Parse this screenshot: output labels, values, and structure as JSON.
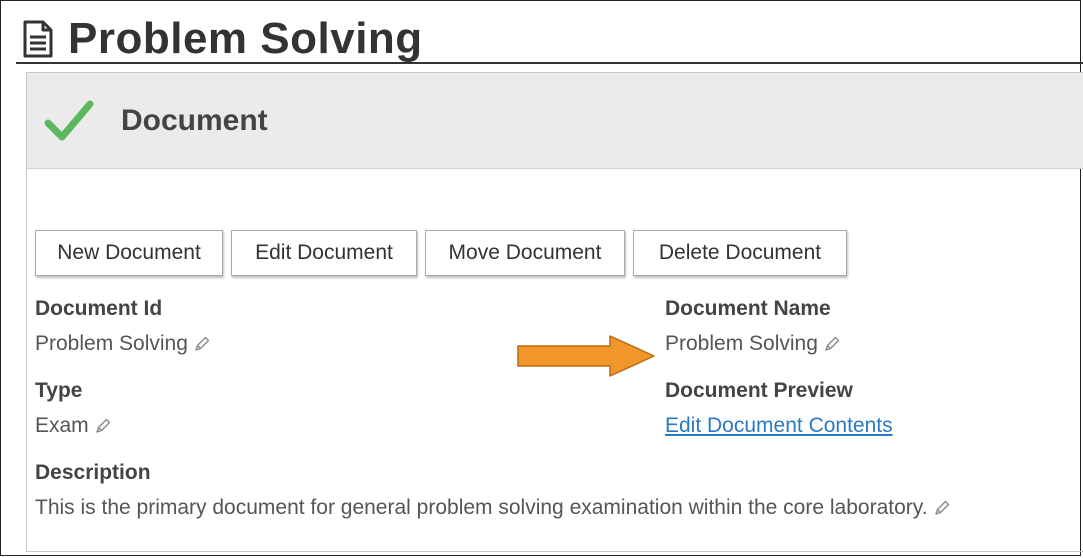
{
  "page": {
    "title": "Problem Solving"
  },
  "panel": {
    "title": "Document"
  },
  "toolbar": {
    "new_label": "New Document",
    "edit_label": "Edit Document",
    "move_label": "Move Document",
    "delete_label": "Delete Document"
  },
  "fields": {
    "document_id": {
      "label": "Document Id",
      "value": "Problem Solving"
    },
    "document_name": {
      "label": "Document Name",
      "value": "Problem Solving"
    },
    "type": {
      "label": "Type",
      "value": "Exam"
    },
    "document_preview": {
      "label": "Document Preview",
      "link_text": "Edit Document Contents"
    },
    "description": {
      "label": "Description",
      "value": "This is the primary document for general problem solving examination within the core laboratory."
    }
  },
  "icons": {
    "page": "document-icon",
    "status": "checkmark-icon",
    "edit": "pencil-icon",
    "callout": "arrow-right-icon"
  },
  "colors": {
    "check": "#5cb85c",
    "link": "#2a7ac6",
    "arrow": "#f0962a",
    "header_bg": "#ebebeb"
  }
}
